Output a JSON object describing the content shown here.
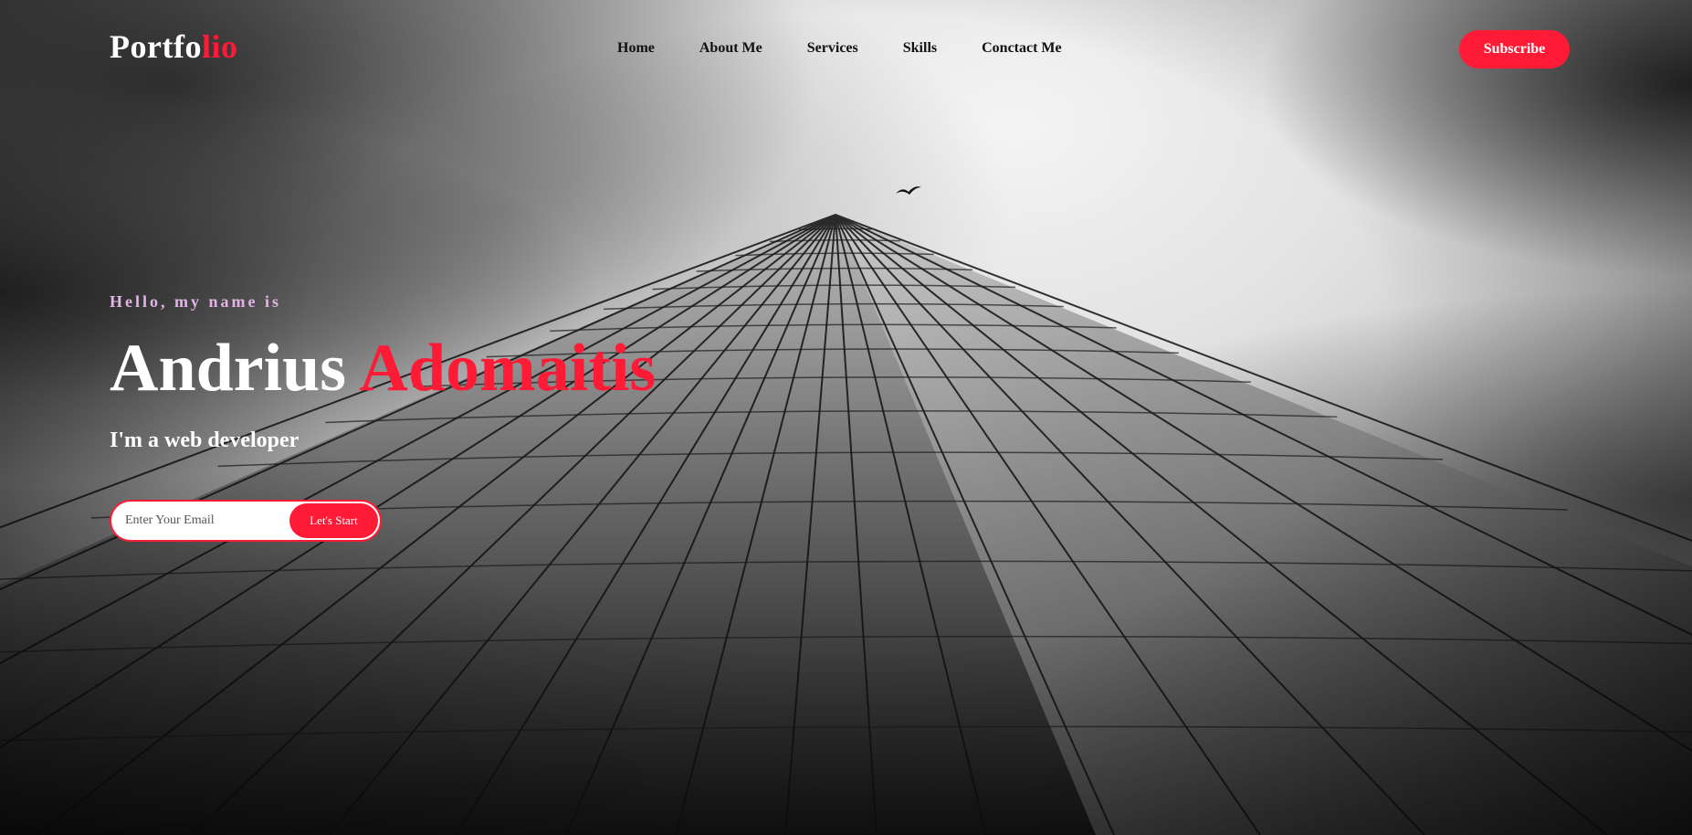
{
  "header": {
    "logo_main": "Portfo",
    "logo_accent": "lio",
    "nav": [
      {
        "label": "Home"
      },
      {
        "label": "About Me"
      },
      {
        "label": "Services"
      },
      {
        "label": "Skills"
      },
      {
        "label": "Conctact Me"
      }
    ],
    "subscribe_label": "Subscribe"
  },
  "hero": {
    "greeting": "Hello, my name is",
    "first_name": "Andrius",
    "last_name": "Adomaitis",
    "tagline": "I'm a web developer",
    "email_value": "",
    "email_placeholder": "Enter Your Email",
    "cta_label": "Let's Start"
  },
  "theme": {
    "accent": "#ff1a36",
    "greeting_color": "#e4b4e8",
    "text": "#ffffff"
  },
  "icons": [
    "bird-icon"
  ]
}
